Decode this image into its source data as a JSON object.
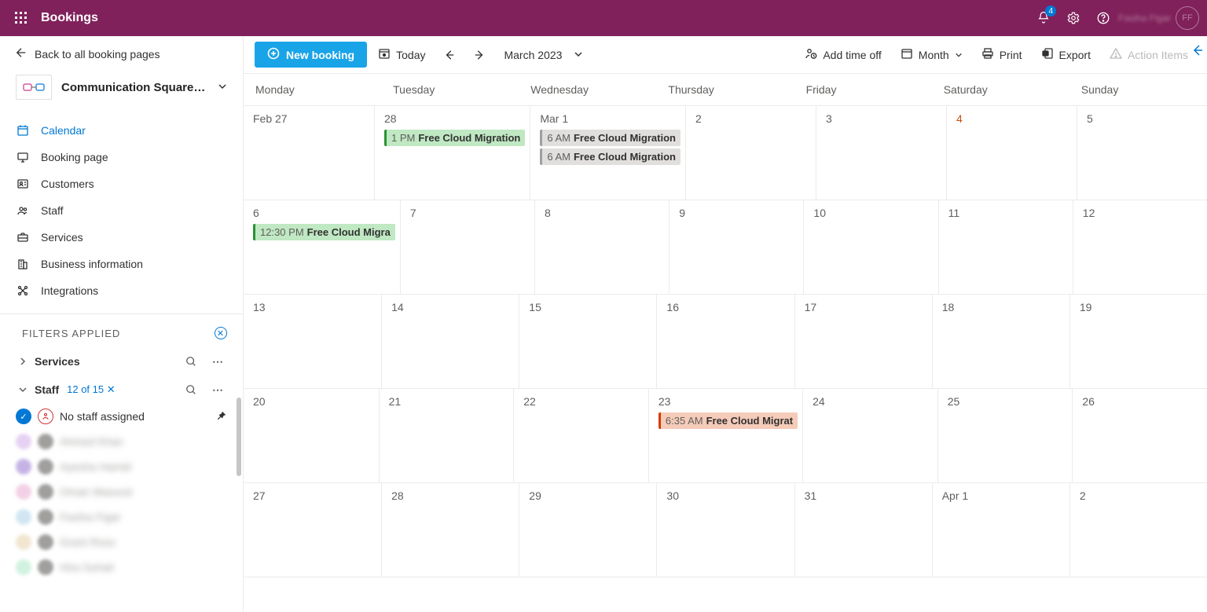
{
  "topbar": {
    "app_title": "Bookings",
    "notification_count": "4",
    "user_name": "Fasiha Figar"
  },
  "sidebar": {
    "back_label": "Back to all booking pages",
    "org_name": "Communication Square L...",
    "nav": [
      {
        "label": "Calendar"
      },
      {
        "label": "Booking page"
      },
      {
        "label": "Customers"
      },
      {
        "label": "Staff"
      },
      {
        "label": "Services"
      },
      {
        "label": "Business information"
      },
      {
        "label": "Integrations"
      }
    ],
    "filters_label": "FILTERS APPLIED",
    "services_label": "Services",
    "staff_label": "Staff",
    "staff_count": "12 of 15",
    "no_staff_label": "No staff assigned",
    "staff_list": [
      "Ahmed Khan",
      "Ayesha Hamid",
      "Omair Masood",
      "Fasiha Figar",
      "Grant Ross",
      "Hira Sohail"
    ]
  },
  "cmdbar": {
    "new_booking": "New booking",
    "today": "Today",
    "month_label": "March 2023",
    "add_time_off": "Add time off",
    "view": "Month",
    "print": "Print",
    "export": "Export",
    "action_items": "Action Items"
  },
  "calendar": {
    "day_headers": [
      "Monday",
      "Tuesday",
      "Wednesday",
      "Thursday",
      "Friday",
      "Saturday",
      "Sunday"
    ],
    "weeks": [
      {
        "days": [
          {
            "num": "Feb 27"
          },
          {
            "num": "28",
            "events": [
              {
                "time": "1 PM",
                "title": "Free Cloud Migration",
                "cls": "ev-green"
              }
            ]
          },
          {
            "num": "Mar 1",
            "events": [
              {
                "time": "6 AM",
                "title": "Free Cloud Migration",
                "cls": "ev-gray"
              },
              {
                "time": "6 AM",
                "title": "Free Cloud Migration",
                "cls": "ev-gray"
              }
            ]
          },
          {
            "num": "2"
          },
          {
            "num": "3"
          },
          {
            "num": "4",
            "orange": true
          },
          {
            "num": "5"
          }
        ]
      },
      {
        "days": [
          {
            "num": "6",
            "events": [
              {
                "time": "12:30 PM",
                "title": "Free Cloud Migra",
                "cls": "ev-green2"
              }
            ]
          },
          {
            "num": "7"
          },
          {
            "num": "8"
          },
          {
            "num": "9"
          },
          {
            "num": "10"
          },
          {
            "num": "11"
          },
          {
            "num": "12"
          }
        ]
      },
      {
        "days": [
          {
            "num": "13"
          },
          {
            "num": "14"
          },
          {
            "num": "15"
          },
          {
            "num": "16"
          },
          {
            "num": "17"
          },
          {
            "num": "18"
          },
          {
            "num": "19"
          }
        ]
      },
      {
        "days": [
          {
            "num": "20"
          },
          {
            "num": "21"
          },
          {
            "num": "22"
          },
          {
            "num": "23",
            "events": [
              {
                "time": "6:35 AM",
                "title": "Free Cloud Migrat",
                "cls": "ev-red"
              }
            ]
          },
          {
            "num": "24"
          },
          {
            "num": "25"
          },
          {
            "num": "26"
          }
        ]
      },
      {
        "days": [
          {
            "num": "27"
          },
          {
            "num": "28"
          },
          {
            "num": "29"
          },
          {
            "num": "30"
          },
          {
            "num": "31"
          },
          {
            "num": "Apr 1"
          },
          {
            "num": "2"
          }
        ]
      }
    ]
  }
}
